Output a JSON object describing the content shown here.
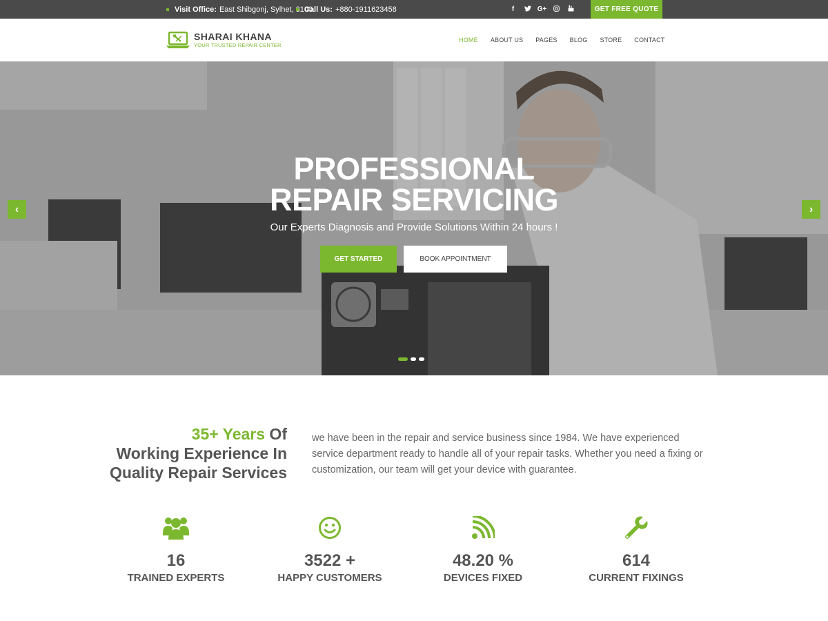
{
  "topbar": {
    "office_label": "Visit Office:",
    "office_value": "East Shibgonj, Sylhet, 3100",
    "call_label": "Call Us:",
    "call_value": "+880-1911623458",
    "socials": [
      "f",
      "t",
      "G+",
      "ig",
      "yt"
    ],
    "quote_button": "GET FREE QUOTE"
  },
  "header": {
    "logo_title": "SHARAI KHANA",
    "logo_tagline": "YOUR TRUSTED REPAIR CENTER",
    "nav": [
      "HOME",
      "ABOUT US",
      "PAGES",
      "BLOG",
      "STORE",
      "CONTACT"
    ],
    "active_nav": "HOME"
  },
  "hero": {
    "title_line1": "PROFESSIONAL",
    "title_line2": "REPAIR SERVICING",
    "subtitle": "Our Experts Diagnosis and Provide Solutions Within 24 hours !",
    "primary_button": "GET STARTED",
    "secondary_button": "BOOK APPOINTMENT",
    "prev_arrow": "‹",
    "next_arrow": "›",
    "slides": 3,
    "active_slide": 1
  },
  "experience": {
    "heading_green": "35+ Years",
    "heading_rest1": " Of",
    "heading_line2": "Working Experience In",
    "heading_line3": "Quality Repair Services",
    "text": "we have been in the repair and service business since 1984. We have experienced service department ready to handle all of your repair tasks. Whether you need a fixing or customization, our team will get your device with guarantee."
  },
  "stats": [
    {
      "icon": "users-icon",
      "value": "16",
      "label": "TRAINED EXPERTS"
    },
    {
      "icon": "smile-icon",
      "value": "3522 +",
      "label": "HAPPY CUSTOMERS"
    },
    {
      "icon": "rss-icon",
      "value": "48.20 %",
      "label": "DEVICES FIXED"
    },
    {
      "icon": "wrench-icon",
      "value": "614",
      "label": "CURRENT FIXINGS"
    }
  ],
  "colors": {
    "accent": "#7cb82f",
    "topbar": "#4a4a4a",
    "text": "#555555"
  }
}
